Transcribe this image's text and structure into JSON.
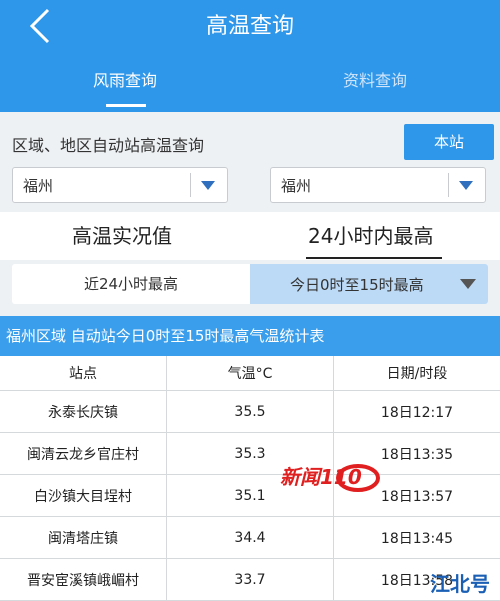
{
  "header": {
    "title": "高温查询",
    "tabs": [
      {
        "label": "风雨查询",
        "active": true
      },
      {
        "label": "资料查询",
        "active": false
      }
    ]
  },
  "query": {
    "label": "区域、地区自动站高温查询",
    "button": "本站",
    "select_left": "福州",
    "select_right": "福州"
  },
  "modes": [
    {
      "label": "高温实况值",
      "active": false
    },
    {
      "label": "24小时内最高",
      "active": true
    }
  ],
  "range": {
    "left": "近24小时最高",
    "right": "今日0时至15时最高"
  },
  "table": {
    "title": "福州区域 自动站今日0时至15时最高气温统计表",
    "headers": [
      "站点",
      "气温°C",
      "日期/时段"
    ],
    "rows": [
      [
        "永泰长庆镇",
        "35.5",
        "18日12:17"
      ],
      [
        "闽清云龙乡官庄村",
        "35.3",
        "18日13:35"
      ],
      [
        "白沙镇大目埕村",
        "35.1",
        "18日13:57"
      ],
      [
        "闽清塔庄镇",
        "34.4",
        "18日13:45"
      ],
      [
        "晋安宦溪镇峨嵋村",
        "33.7",
        "18日13:58"
      ]
    ]
  },
  "overlay": {
    "logo_text": "新闻110",
    "watermark": "江北号"
  },
  "colors": {
    "primary": "#2f97ea",
    "range_selected": "#bcd9f5",
    "logo_red": "#e02020"
  }
}
